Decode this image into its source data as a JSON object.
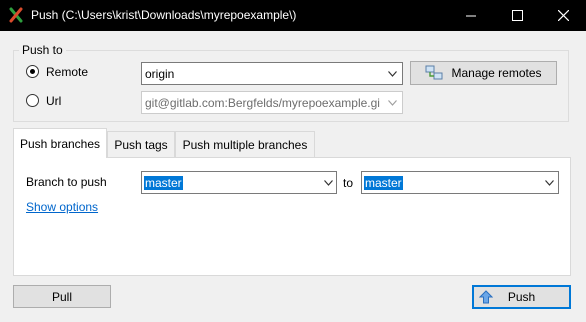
{
  "window": {
    "title": "Push (C:\\Users\\krist\\Downloads\\myrepoexample\\)",
    "app_icon": "git-extensions-icon",
    "controls": [
      "minimize-icon",
      "maximize-icon",
      "close-icon"
    ]
  },
  "push_to": {
    "group_label": "Push to",
    "remote_label": "Remote",
    "remote_selected": true,
    "remote_value": "origin",
    "manage_remotes_label": "Manage remotes",
    "url_label": "Url",
    "url_value": "git@gitlab.com:Bergfelds/myrepoexample.gi"
  },
  "tabs": [
    {
      "label": "Push branches",
      "active": true
    },
    {
      "label": "Push tags",
      "active": false
    },
    {
      "label": "Push multiple branches",
      "active": false
    }
  ],
  "push_branches": {
    "branch_label": "Branch to push",
    "branch_value": "master",
    "to_label": "to",
    "remote_branch_value": "master",
    "show_options_label": "Show options"
  },
  "footer": {
    "pull_label": "Pull",
    "push_label": "Push"
  },
  "colors": {
    "accent": "#0078d7",
    "link": "#0066cc",
    "titlebar": "#000000"
  }
}
